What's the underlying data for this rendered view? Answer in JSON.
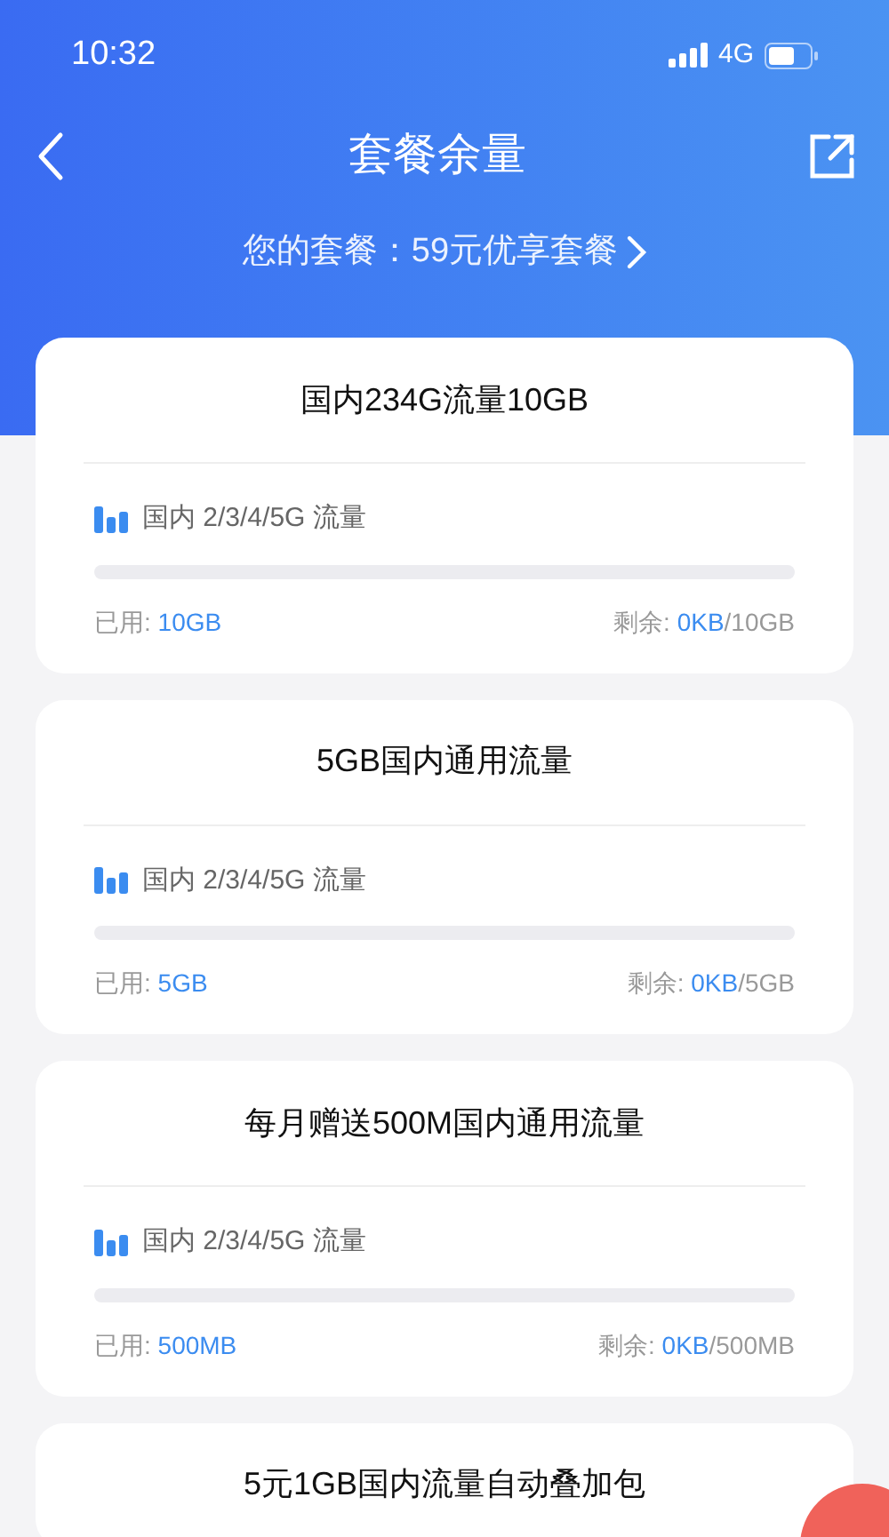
{
  "status_bar": {
    "time": "10:32",
    "network": "4G"
  },
  "header": {
    "title": "套餐余量",
    "plan_label": "您的套餐：59元优享套餐"
  },
  "cards": [
    {
      "title": "国内234G流量10GB",
      "item_label": "国内 2/3/4/5G 流量",
      "level": 0,
      "used_label": "已用: ",
      "used_value": "10GB",
      "remaining_label": "剩余: ",
      "remaining_value": "0KB",
      "remaining_total": "/10GB"
    },
    {
      "title": "5GB国内通用流量",
      "item_label": "国内 2/3/4/5G 流量",
      "level": 0,
      "used_label": "已用: ",
      "used_value": "5GB",
      "remaining_label": "剩余: ",
      "remaining_value": "0KB",
      "remaining_total": "/5GB"
    },
    {
      "title": "每月赠送500M国内通用流量",
      "item_label": "国内 2/3/4/5G 流量",
      "level": 0,
      "used_label": "已用: ",
      "used_value": "500MB",
      "remaining_label": "剩余: ",
      "remaining_value": "0KB",
      "remaining_total": "/500MB"
    },
    {
      "title": "5元1GB国内流量自动叠加包"
    }
  ]
}
